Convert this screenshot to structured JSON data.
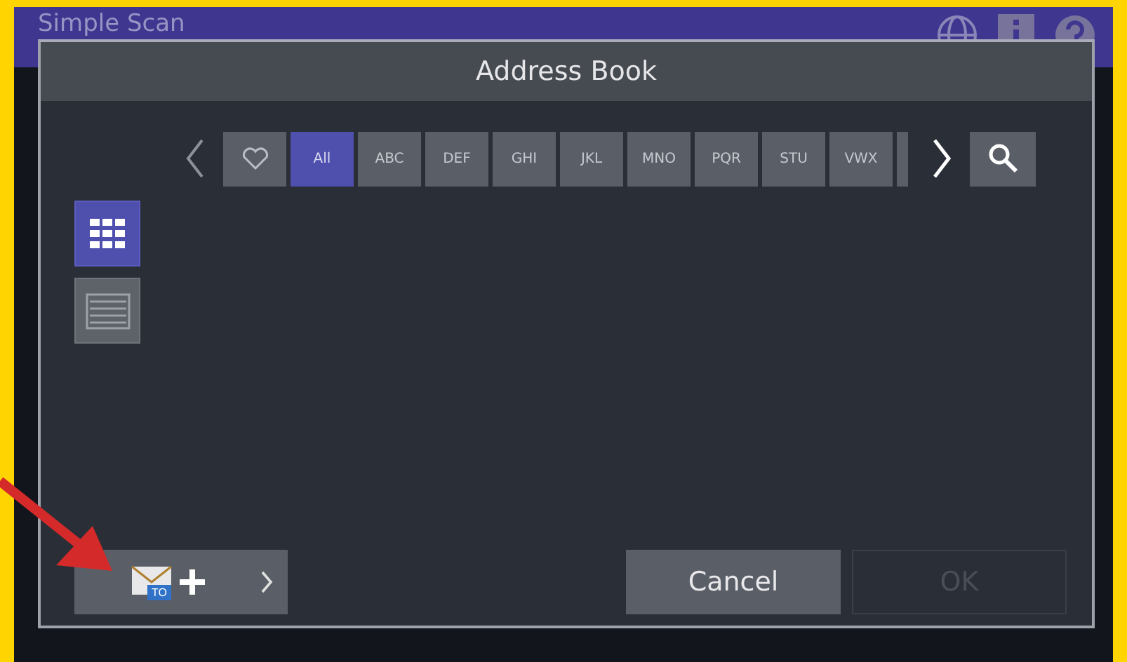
{
  "app": {
    "title": "Simple Scan"
  },
  "dialog": {
    "title": "Address Book",
    "index_tabs": [
      {
        "kind": "favorite",
        "selected": false
      },
      {
        "kind": "letters",
        "label": "All",
        "selected": true
      },
      {
        "kind": "letters",
        "label": "ABC",
        "selected": false
      },
      {
        "kind": "letters",
        "label": "DEF",
        "selected": false
      },
      {
        "kind": "letters",
        "label": "GHI",
        "selected": false
      },
      {
        "kind": "letters",
        "label": "JKL",
        "selected": false
      },
      {
        "kind": "letters",
        "label": "MNO",
        "selected": false
      },
      {
        "kind": "letters",
        "label": "PQR",
        "selected": false
      },
      {
        "kind": "letters",
        "label": "STU",
        "selected": false
      },
      {
        "kind": "letters",
        "label": "VWX",
        "selected": false
      },
      {
        "kind": "partial",
        "selected": false
      }
    ],
    "view_modes": [
      {
        "kind": "grid",
        "selected": true
      },
      {
        "kind": "list",
        "selected": false
      }
    ],
    "add_button": {
      "badge": "TO"
    },
    "buttons": [
      {
        "label": "Cancel",
        "disabled": false
      },
      {
        "label": "OK",
        "disabled": true
      }
    ]
  }
}
